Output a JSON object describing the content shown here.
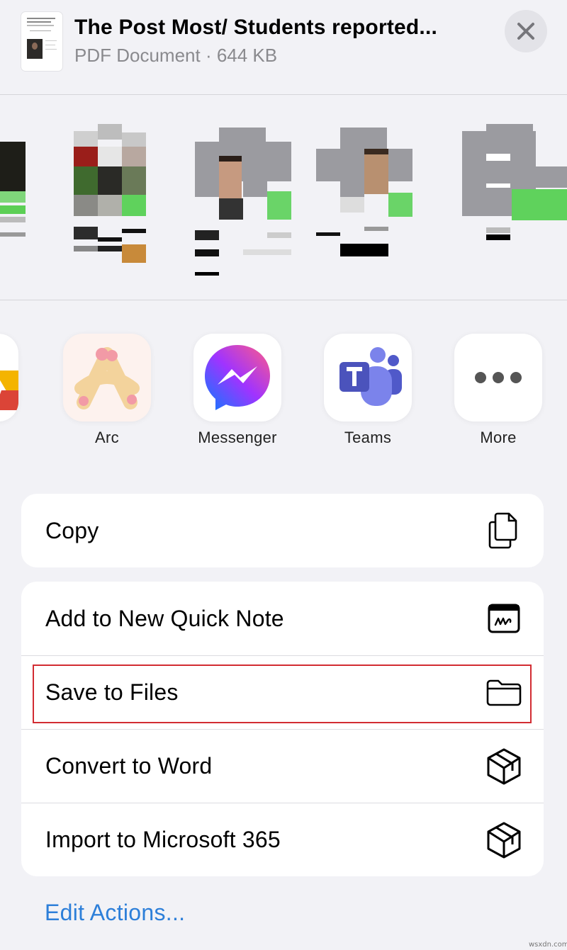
{
  "header": {
    "title": "The Post Most/ Students reported...",
    "subtitle": "PDF Document · 644 KB",
    "close_icon": "close-icon"
  },
  "contacts": {
    "note": "pixelated contact avatars"
  },
  "apps": [
    {
      "label": "",
      "icon": "google-drive-icon"
    },
    {
      "label": "Arc",
      "icon": "arc-icon"
    },
    {
      "label": "Messenger",
      "icon": "messenger-icon"
    },
    {
      "label": "Teams",
      "icon": "teams-icon"
    },
    {
      "label": "More",
      "icon": "more-icon"
    }
  ],
  "actions": {
    "copy": {
      "label": "Copy",
      "icon": "copy-icon"
    },
    "quick_note": {
      "label": "Add to New Quick Note",
      "icon": "quick-note-icon"
    },
    "save_files": {
      "label": "Save to Files",
      "icon": "folder-icon"
    },
    "convert_word": {
      "label": "Convert to Word",
      "icon": "microsoft-365-icon"
    },
    "import_m365": {
      "label": "Import to Microsoft 365",
      "icon": "microsoft-365-icon"
    }
  },
  "footer": {
    "edit_actions": "Edit Actions..."
  },
  "watermark": "wsxdn.com",
  "colors": {
    "accent": "#2d7fd9",
    "highlight": "#d22c32",
    "background": "#f2f2f6"
  }
}
